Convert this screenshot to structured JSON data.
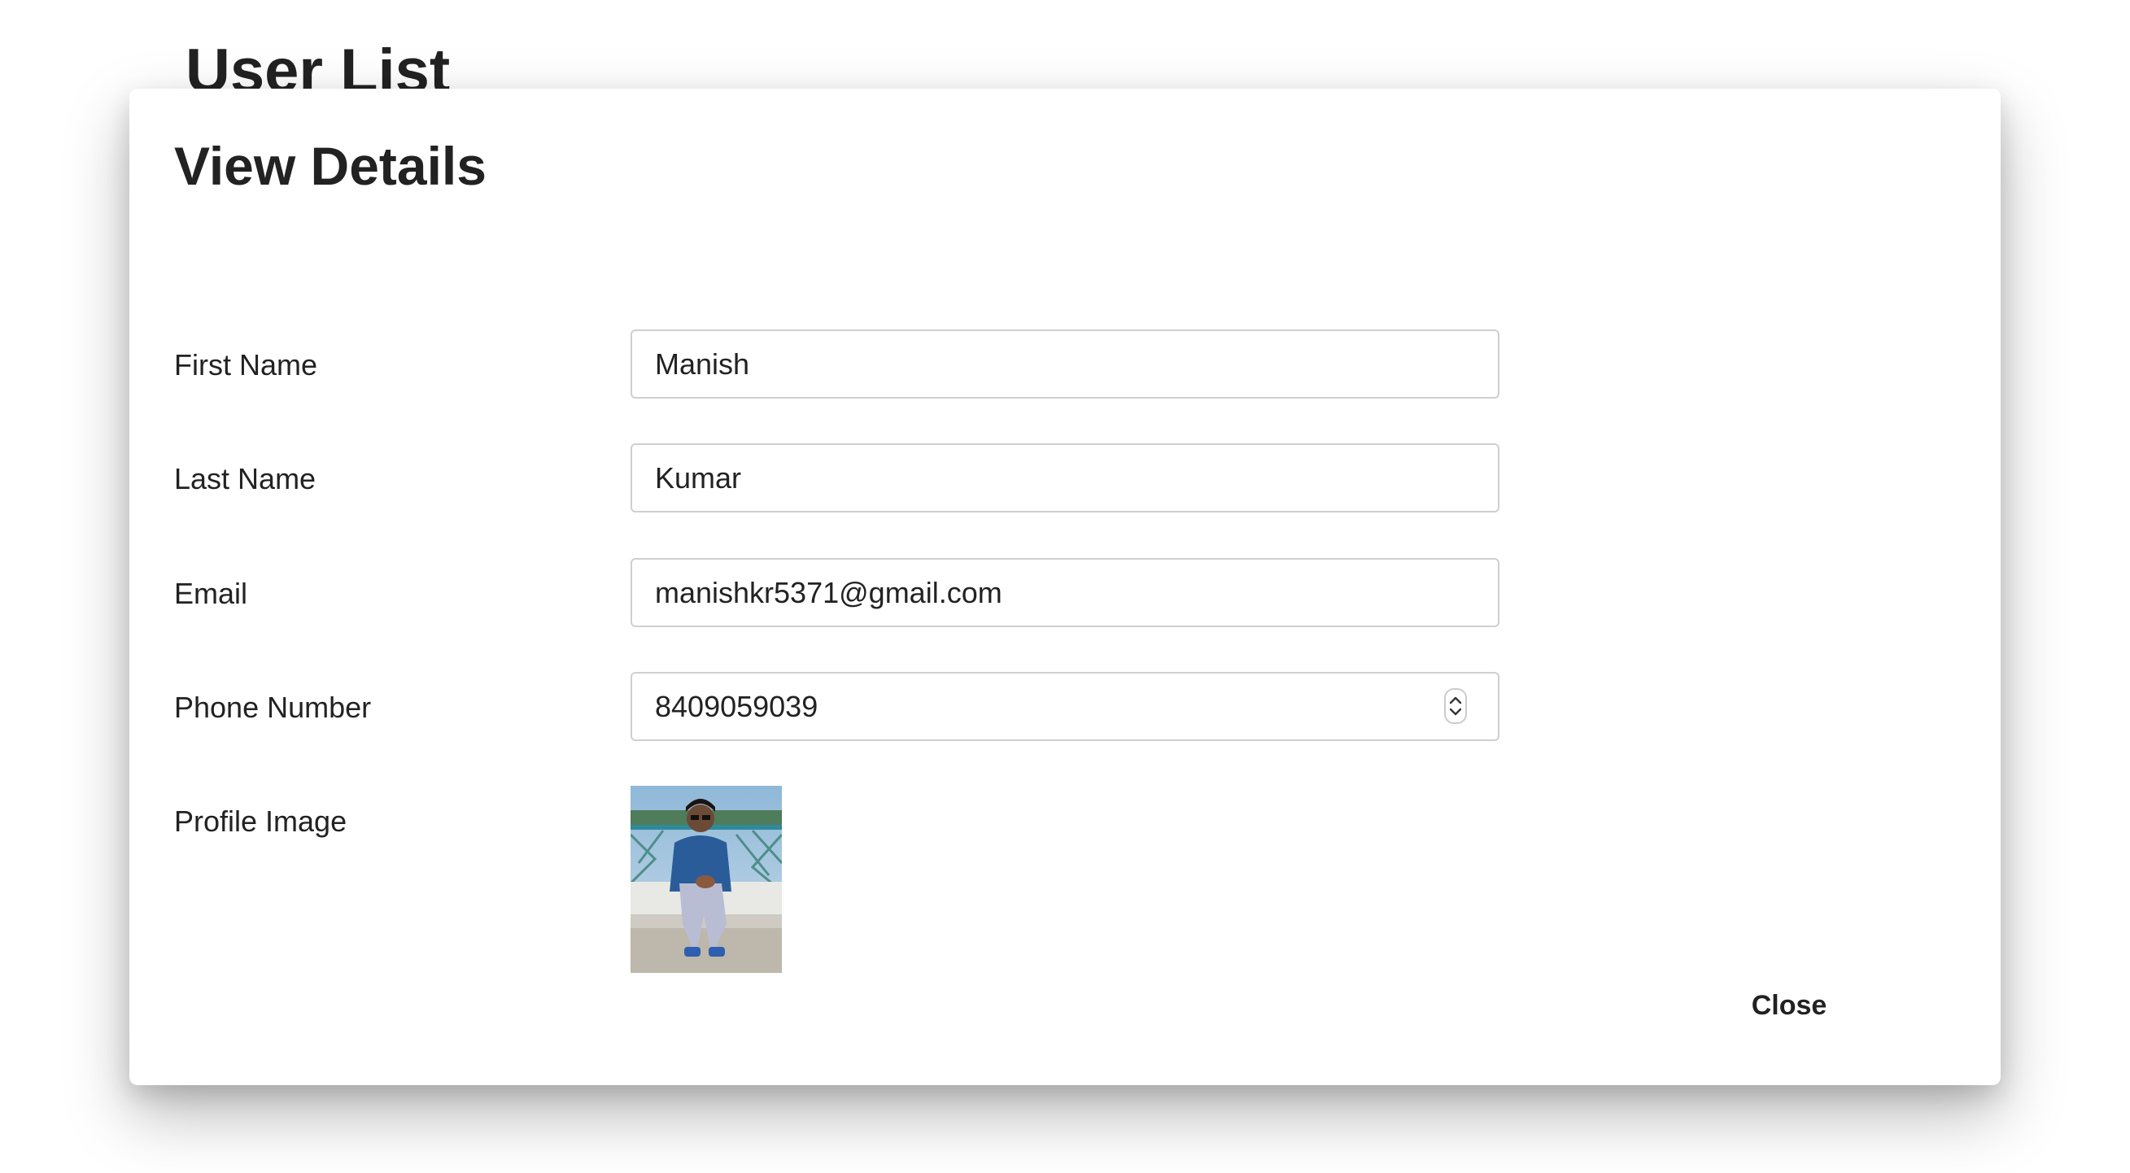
{
  "background": {
    "page_title": "User List"
  },
  "dialog": {
    "title": "View Details",
    "fields": {
      "first_name": {
        "label": "First Name",
        "value": "Manish"
      },
      "last_name": {
        "label": "Last Name",
        "value": "Kumar"
      },
      "email": {
        "label": "Email",
        "value": "manishkr5371@gmail.com"
      },
      "phone": {
        "label": "Phone Number",
        "value": "8409059039"
      },
      "profile_image": {
        "label": "Profile Image"
      }
    },
    "close_label": "Close"
  },
  "icons": {
    "spinner": "number-spinner-icon",
    "profile": "profile-photo"
  },
  "colors": {
    "text": "#222222",
    "input_border": "#cfcfcf",
    "dialog_bg": "#ffffff"
  }
}
